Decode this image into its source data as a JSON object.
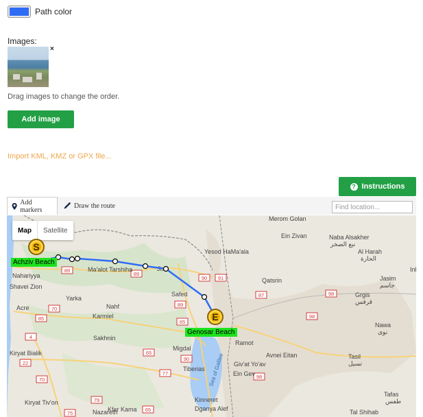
{
  "path_color": {
    "label": "Path color",
    "value": "#2f6cf6"
  },
  "images": {
    "label": "Images:",
    "remove_symbol": "×",
    "drag_hint": "Drag images to change the order.",
    "add_button": "Add image"
  },
  "import_link": "Import KML, KMZ or GPX file...",
  "instructions_button": "Instructions",
  "toolbar": {
    "add_markers": "Add markers",
    "draw_route": "Draw the route",
    "find_placeholder": "Find location..."
  },
  "map": {
    "type_map": "Map",
    "type_satellite": "Satellite",
    "start_marker": "S",
    "end_marker": "E",
    "start_label": "Achziv Beach",
    "end_label": "Genosar Beach",
    "route_color": "#2f6cf6",
    "places": [
      "Merom Golan",
      "Ein Zivan",
      "Naba Alsakher",
      "نبع الصخر",
      "Al Harah",
      "الحارة",
      "Yesod HaMa'ala",
      "Nahariyya",
      "Ma'alot Tarshiha",
      "Jish",
      "Qatsrin",
      "Jasim",
      "جاسم",
      "Ink",
      "Shavei Zion",
      "Safed",
      "Grgis",
      "قرقس",
      "Yarka",
      "Acre",
      "Nahf",
      "Karmiel",
      "Nawa",
      "نوى",
      "Sakhnin",
      "Kiryat Bialik",
      "Migdal",
      "Ramot",
      "Avnei Eitan",
      "Tasil",
      "تسيل",
      "Tiberias",
      "Sea of Galilee",
      "Kfar Kama",
      "Ein Gev",
      "Giv'at Yo'av",
      "Kiryat Tiv'on",
      "Kinneret",
      "Nazareth",
      "Dganya Alef",
      "Tafas",
      "طفس",
      "Tal Shihab"
    ],
    "routes": [
      "89",
      "90",
      "91",
      "89",
      "87",
      "89",
      "98",
      "70",
      "85",
      "65",
      "98",
      "4",
      "22",
      "65",
      "90",
      "77",
      "98",
      "70",
      "79",
      "75",
      "65"
    ]
  }
}
